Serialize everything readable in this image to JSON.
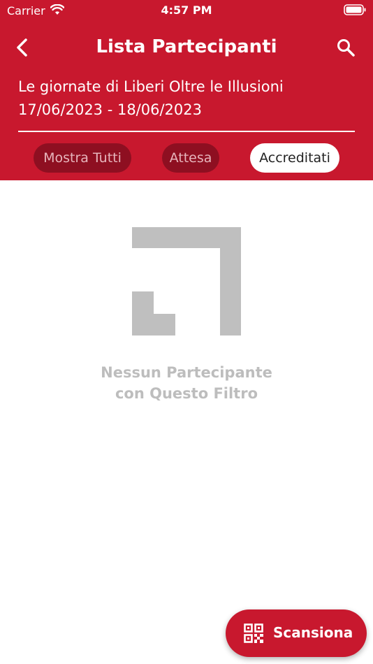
{
  "status_bar": {
    "carrier": "Carrier",
    "time": "4:57 PM"
  },
  "nav": {
    "title": "Lista Partecipanti",
    "back_icon": "chevron-left-icon",
    "search_icon": "search-icon"
  },
  "event": {
    "name": "Le giornate di Liberi Oltre le Illusioni",
    "dates": "17/06/2023 - 18/06/2023"
  },
  "filters": [
    {
      "label": "Mostra Tutti",
      "selected": false
    },
    {
      "label": "Attesa",
      "selected": false
    },
    {
      "label": "Accreditati",
      "selected": true
    }
  ],
  "empty_state": {
    "line1": "Nessun Partecipante",
    "line2": "con Questo Filtro",
    "icon": "empty-list-icon"
  },
  "fab": {
    "label": "Scansiona",
    "icon": "qr-code-icon"
  },
  "colors": {
    "primary": "#C8182E",
    "chip_inactive_bg": "#8E0F21",
    "chip_inactive_text": "#E7B5BC",
    "empty_text": "#BDBDBD"
  }
}
